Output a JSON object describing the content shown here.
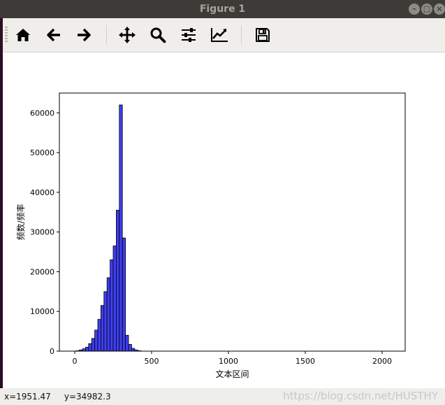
{
  "window": {
    "title": "Figure 1"
  },
  "toolbar": {
    "buttons": [
      {
        "name": "home-button",
        "icon": "home-icon"
      },
      {
        "name": "back-button",
        "icon": "arrow-left-icon"
      },
      {
        "name": "forward-button",
        "icon": "arrow-right-icon"
      },
      {
        "name": "pan-button",
        "icon": "move-arrows-icon"
      },
      {
        "name": "zoom-button",
        "icon": "magnifier-icon"
      },
      {
        "name": "configure-subplots-button",
        "icon": "sliders-icon"
      },
      {
        "name": "edit-axis-button",
        "icon": "line-chart-icon"
      },
      {
        "name": "save-button",
        "icon": "floppy-disk-icon"
      }
    ]
  },
  "status": {
    "coords": "x=1951.47     y=34982.3"
  },
  "watermark": "https://blog.csdn.net/HUSTHY",
  "chart_data": {
    "type": "bar",
    "xlabel": "文本区间",
    "ylabel": "频数/频率",
    "xlim": [
      -100,
      2150
    ],
    "ylim": [
      0,
      65000
    ],
    "xticks": [
      0,
      500,
      1000,
      1500,
      2000
    ],
    "yticks": [
      0,
      10000,
      20000,
      30000,
      40000,
      50000,
      60000
    ],
    "bin_width": 20,
    "bar_color": "#3e3ef0",
    "edge_color": "#000000",
    "bins": [
      {
        "x": 20,
        "value": 100
      },
      {
        "x": 40,
        "value": 300
      },
      {
        "x": 60,
        "value": 600
      },
      {
        "x": 80,
        "value": 1000
      },
      {
        "x": 100,
        "value": 1900
      },
      {
        "x": 120,
        "value": 3200
      },
      {
        "x": 140,
        "value": 5300
      },
      {
        "x": 160,
        "value": 8000
      },
      {
        "x": 180,
        "value": 11500
      },
      {
        "x": 200,
        "value": 15000
      },
      {
        "x": 220,
        "value": 18500
      },
      {
        "x": 240,
        "value": 23000
      },
      {
        "x": 260,
        "value": 26500
      },
      {
        "x": 280,
        "value": 35500
      },
      {
        "x": 300,
        "value": 62000
      },
      {
        "x": 320,
        "value": 28500
      },
      {
        "x": 340,
        "value": 4000
      },
      {
        "x": 360,
        "value": 1700
      },
      {
        "x": 380,
        "value": 700
      },
      {
        "x": 400,
        "value": 300
      },
      {
        "x": 420,
        "value": 100
      }
    ]
  }
}
